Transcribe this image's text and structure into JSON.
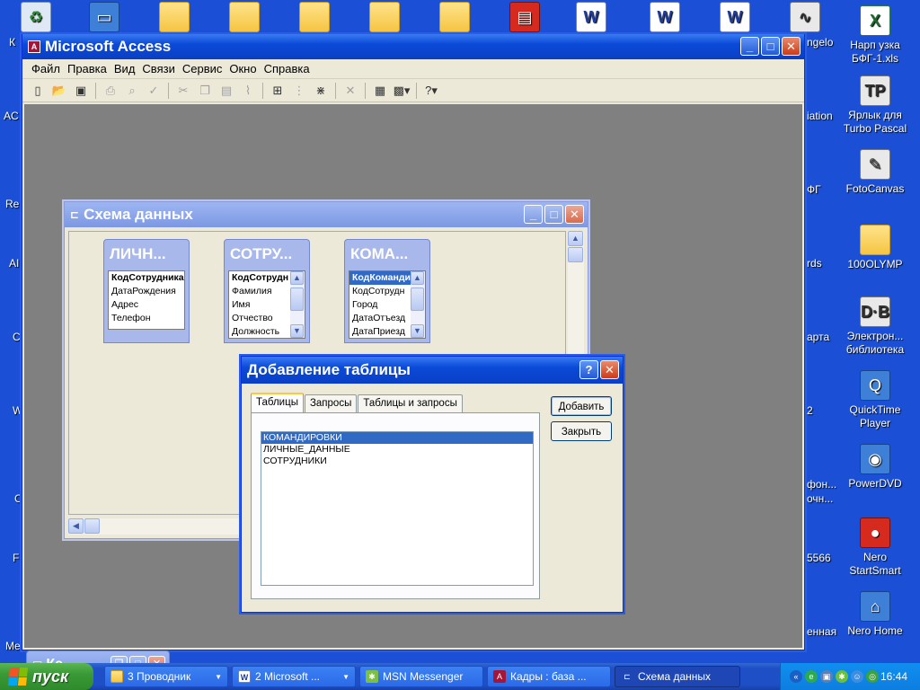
{
  "desktop": {
    "icons": [
      {
        "label": "Нарп узка БФГ-1.xls",
        "line1": "Нарп узка",
        "line2": "БФГ-1.xls"
      },
      {
        "label": "Ярлык для Turbo Pascal",
        "line1": "Ярлык для",
        "line2": "Turbo Pascal"
      },
      {
        "label": "FotoCanvas",
        "line1": "FotoCanvas",
        "line2": ""
      },
      {
        "label": "100OLYMP",
        "line1": "100OLYMP",
        "line2": ""
      },
      {
        "label": "Электрон... библиотека",
        "line1": "Электрон...",
        "line2": "библиотека"
      },
      {
        "label": "QuickTime Player",
        "line1": "QuickTime",
        "line2": "Player"
      },
      {
        "label": "PowerDVD",
        "line1": "PowerDVD",
        "line2": ""
      },
      {
        "label": "Nero StartSmart",
        "line1": "Nero",
        "line2": "StartSmart"
      },
      {
        "label": "Nero Home",
        "line1": "Nero Home",
        "line2": ""
      }
    ],
    "partial_labels": [
      "ngelo",
      "iation",
      "ФГ",
      "rds",
      "арта",
      "2",
      "фон...",
      "очн...",
      "5566",
      "енная",
      "AC",
      "Re",
      "AI",
      "C",
      "W",
      "C",
      "F",
      "Me",
      "К"
    ]
  },
  "access": {
    "title": "Microsoft Access",
    "menu": [
      "Файл",
      "Правка",
      "Вид",
      "Связи",
      "Сервис",
      "Окно",
      "Справка"
    ]
  },
  "schema": {
    "title": "Схема данных",
    "tables": [
      {
        "title": "ЛИЧН...",
        "fields": [
          "КодСотрудника",
          "ДатаРождения",
          "Адрес",
          "Телефон"
        ]
      },
      {
        "title": "СОТРУ...",
        "fields": [
          "КодСотрудн",
          "Фамилия",
          "Имя",
          "Отчество",
          "Должность"
        ]
      },
      {
        "title": "КОМА...",
        "fields": [
          "КодКоманди",
          "КодСотрудн",
          "Город",
          "ДатаОтъезд",
          "ДатаПриезд"
        ]
      }
    ]
  },
  "dialog": {
    "title": "Добавление таблицы",
    "tabs": [
      "Таблицы",
      "Запросы",
      "Таблицы и запросы"
    ],
    "list": [
      "КОМАНДИРОВКИ",
      "ЛИЧНЫЕ_ДАННЫЕ",
      "СОТРУДНИКИ"
    ],
    "add_label": "Добавить",
    "close_label": "Закрыть"
  },
  "minimized": {
    "title": "Ка..."
  },
  "taskbar": {
    "start": "пуск",
    "tasks": [
      "3 Проводник",
      "2 Microsoft ...",
      "MSN Messenger",
      "Кадры : база ...",
      "Схема данных"
    ],
    "clock": "16:44"
  }
}
